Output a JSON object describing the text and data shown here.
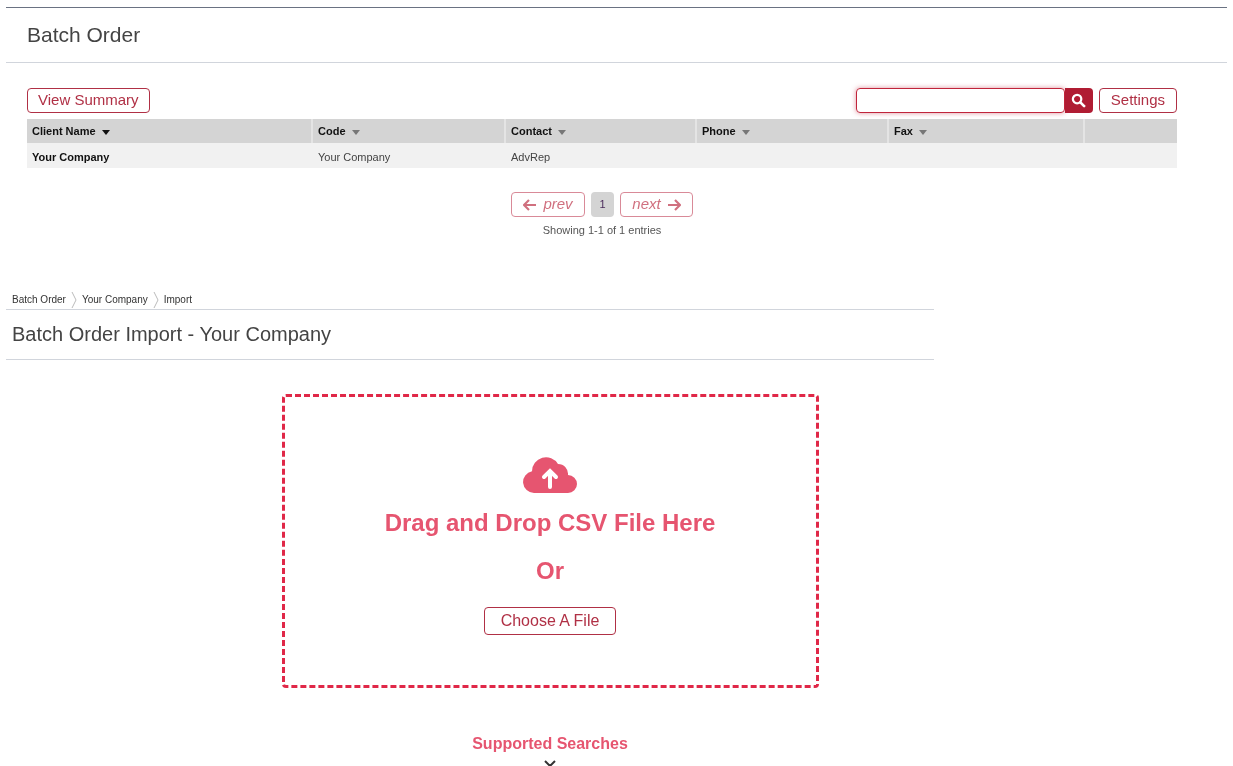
{
  "page_title": "Batch Order",
  "toolbar": {
    "view_summary": "View Summary",
    "search": {
      "focused": true
    },
    "settings": "Settings"
  },
  "table": {
    "columns": [
      {
        "label": "Client Name",
        "selected": true
      },
      {
        "label": "Code",
        "selected": false
      },
      {
        "label": "Contact",
        "selected": false
      },
      {
        "label": "Phone",
        "selected": false
      },
      {
        "label": "Fax",
        "selected": false
      }
    ],
    "rows": [
      {
        "cells": [
          "Your Company",
          "Your Company",
          "AdvRep",
          "",
          ""
        ]
      }
    ]
  },
  "pagination": {
    "prev": "prev",
    "pages": [
      {
        "label": "1",
        "selected": true
      }
    ],
    "next": "next",
    "info": "Showing 1-1 of 1 entries"
  },
  "breadcrumb": [
    "Batch Order",
    "Your Company",
    "Import"
  ],
  "import_title": "Batch Order Import - Your Company",
  "dropzone": {
    "heading": "Drag and Drop CSV File Here",
    "or": "Or",
    "button": "Choose A File"
  },
  "supported_searches": {
    "label": "Supported Searches",
    "expanded": false
  }
}
